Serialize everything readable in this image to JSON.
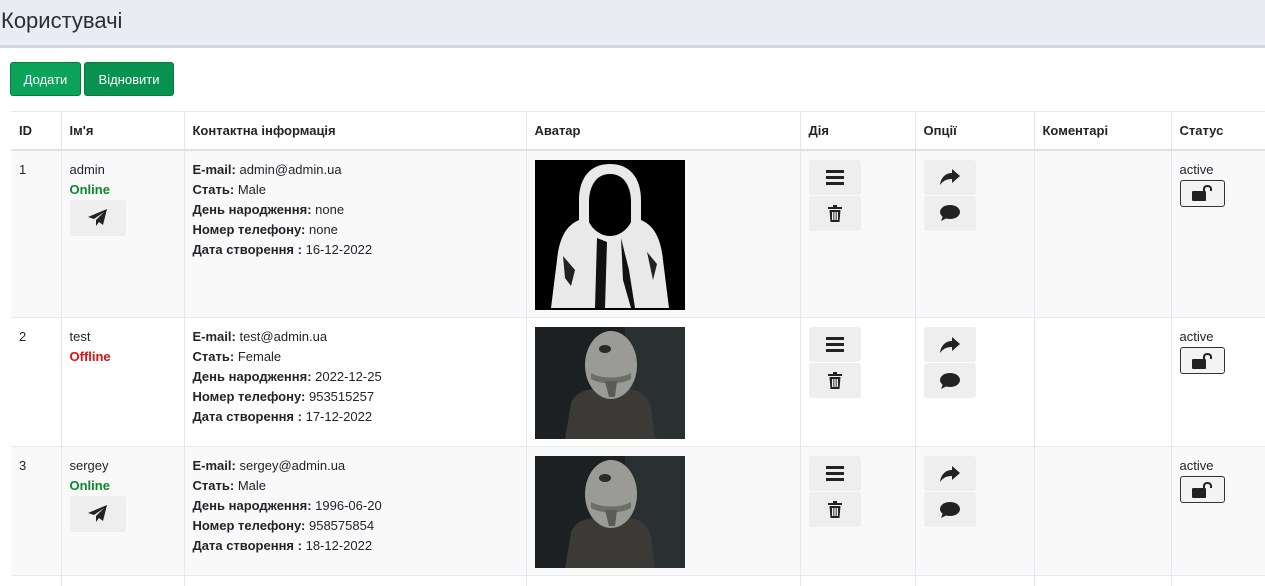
{
  "header": {
    "title": "Користувачі"
  },
  "toolbar": {
    "add_label": "Додати",
    "restore_label": "Відновити"
  },
  "table": {
    "columns": {
      "id": "ID",
      "name": "Ім'я",
      "contact": "Контактна інформація",
      "avatar": "Аватар",
      "action": "Дія",
      "options": "Опції",
      "comments": "Коментарі",
      "status": "Статус"
    },
    "contact_labels": {
      "email": "E-mail:",
      "gender": "Стать:",
      "birthday": "День народження:",
      "phone": "Номер телефону:",
      "created": "Дата створення :"
    },
    "rows": [
      {
        "id": "1",
        "name": "admin",
        "presence": "Online",
        "email": "admin@admin.ua",
        "gender": "Male",
        "birthday": "none",
        "phone": "none",
        "created": "16-12-2022",
        "status": "active",
        "avatar": "hooded-figure"
      },
      {
        "id": "2",
        "name": "test",
        "presence": "Offline",
        "email": "test@admin.ua",
        "gender": "Female",
        "birthday": "2022-12-25",
        "phone": "953515257",
        "created": "17-12-2022",
        "status": "active",
        "avatar": "masked-figure"
      },
      {
        "id": "3",
        "name": "sergey",
        "presence": "Online",
        "email": "sergey@admin.ua",
        "gender": "Male",
        "birthday": "1996-06-20",
        "phone": "958575854",
        "created": "18-12-2022",
        "status": "active",
        "avatar": "masked-figure"
      }
    ]
  },
  "icons": {
    "send": "paper-plane-icon",
    "menu": "bars-icon",
    "delete": "trash-icon",
    "share": "share-icon",
    "comment": "comment-icon",
    "lock": "unlock-icon"
  },
  "colors": {
    "online": "#0a8a2a",
    "offline": "#dd1111",
    "button_green": "#0ba35a"
  }
}
